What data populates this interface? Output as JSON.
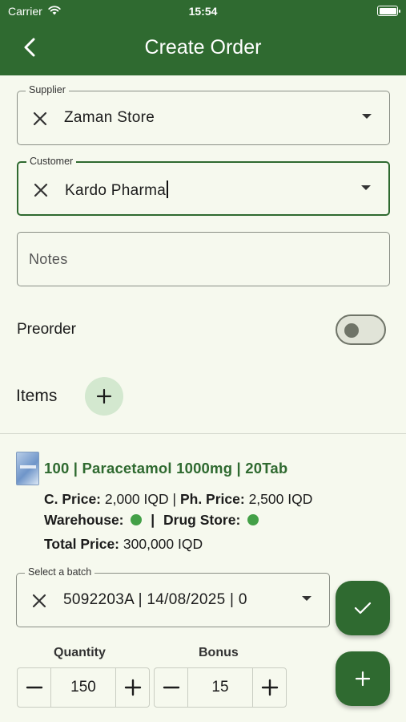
{
  "status_bar": {
    "carrier": "Carrier",
    "time": "15:54"
  },
  "app_bar": {
    "title": "Create Order"
  },
  "supplier": {
    "label": "Supplier",
    "value": "Zaman Store"
  },
  "customer": {
    "label": "Customer",
    "value": "Kardo Pharma"
  },
  "notes": {
    "placeholder": "Notes"
  },
  "preorder": {
    "label": "Preorder",
    "enabled": false
  },
  "items": {
    "label": "Items",
    "list": [
      {
        "title": "100 | Paracetamol 1000mg | 20Tab",
        "c_price_label": "C. Price:",
        "c_price": "2,000 IQD",
        "separator": "|",
        "ph_price_label": "Ph. Price:",
        "ph_price": "2,500 IQD",
        "warehouse_label": "Warehouse:",
        "drug_store_label": "Drug Store:",
        "total_label": "Total Price:",
        "total": "300,000 IQD",
        "batch_label": "Select a batch",
        "batch_value": "5092203A | 14/08/2025 | 0",
        "quantity_label": "Quantity",
        "quantity": "150",
        "bonus_label": "Bonus",
        "bonus": "15"
      }
    ]
  },
  "colors": {
    "primary": "#2f6a30",
    "background": "#f6f9ee",
    "status_ok": "#43a047",
    "chip_bg": "#d3e8cf"
  }
}
